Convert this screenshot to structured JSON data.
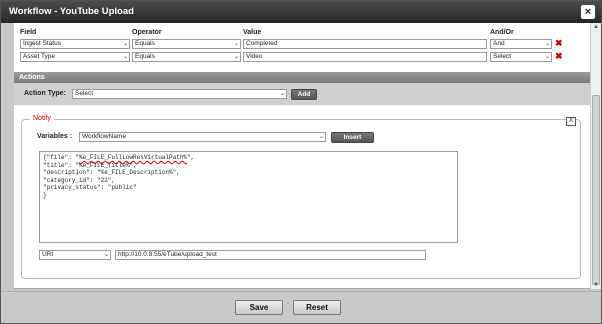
{
  "window": {
    "title": "Workflow - YouTube Upload",
    "close_label": "×"
  },
  "conditions": {
    "headers": {
      "field": "Field",
      "operator": "Operator",
      "value": "Value",
      "andor": "And/Or"
    },
    "rows": [
      {
        "field": "Ingest Status",
        "operator": "Equals",
        "value": "Completed",
        "andor": "And"
      },
      {
        "field": "Asset Type",
        "operator": "Equals",
        "value": "Video",
        "andor": "Select"
      }
    ],
    "delete_icon": "✖"
  },
  "actions": {
    "section_title": "Actions",
    "type_label": "Action Type:",
    "type_value": "Select",
    "add_label": "Add"
  },
  "notify": {
    "legend": "Notify",
    "close_label": "X",
    "variables_label": "Variables :",
    "variables_value": "WorkflowName",
    "insert_label": "Insert",
    "body_lines": [
      "{\"file\": \"%e_FILE_FullLowResVirtualPath%\",",
      "\"title\": \"%e_FILE_Title%\",",
      "\"description\": \"%e_FILE_Description%\",",
      "\"category_id\": \"22\",",
      "\"privacy_status\": \"public\"",
      "}"
    ],
    "method_value": "URI",
    "url_value": "http://10.0.8.55/eTube/upload_test"
  },
  "footer": {
    "save_label": "Save",
    "reset_label": "Reset"
  }
}
